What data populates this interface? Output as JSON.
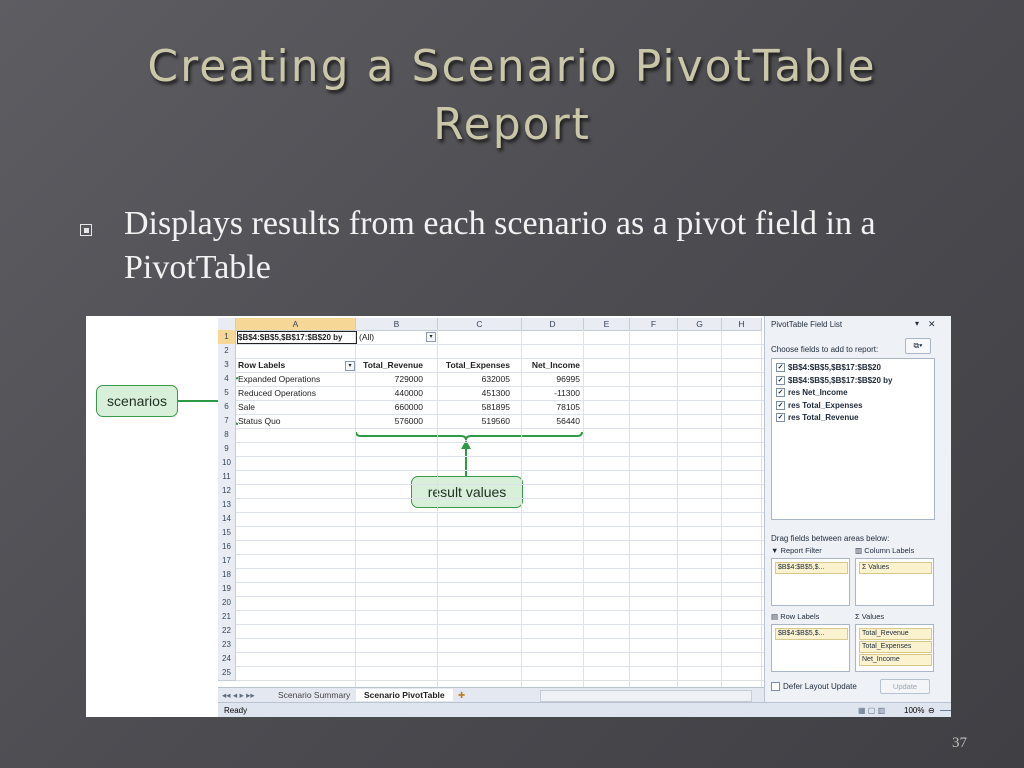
{
  "slide": {
    "title_line1": "Creating a Scenario PivotTable",
    "title_line2": "Report",
    "bullet": "Displays results from each scenario as a pivot field in a PivotTable",
    "slide_number": "37"
  },
  "sheet": {
    "columns": [
      "A",
      "B",
      "C",
      "D",
      "E",
      "F",
      "G",
      "H"
    ],
    "rows": [
      "1",
      "2",
      "3",
      "4",
      "5",
      "6",
      "7",
      "8",
      "9",
      "10",
      "11",
      "12",
      "13",
      "14",
      "15",
      "16",
      "17",
      "18",
      "19",
      "20",
      "21",
      "22",
      "23",
      "24",
      "25"
    ],
    "filter_field": "$B$4:$B$5,$B$17:$B$20 by",
    "filter_value": "(All)",
    "headers": [
      "Row Labels",
      "Total_Revenue",
      "Total_Expenses",
      "Net_Income"
    ],
    "data": [
      [
        "Expanded Operations",
        "729000",
        "632005",
        "96995"
      ],
      [
        "Reduced Operations",
        "440000",
        "451300",
        "-11300"
      ],
      [
        "Sale",
        "660000",
        "581895",
        "78105"
      ],
      [
        "Status Quo",
        "576000",
        "519560",
        "56440"
      ]
    ],
    "tabs": [
      "Scenario Summary",
      "Scenario PivotTable"
    ],
    "status_text": "Ready",
    "zoom": "100%"
  },
  "callouts": {
    "scenarios": "scenarios",
    "result_values": "result values"
  },
  "field_list": {
    "title": "PivotTable Field List",
    "choose_label": "Choose fields to add to report:",
    "fields": [
      {
        "label": "$B$4:$B$5,$B$17:$B$20",
        "checked": true
      },
      {
        "label": "$B$4:$B$5,$B$17:$B$20 by",
        "checked": true
      },
      {
        "label": "res Net_Income",
        "checked": true
      },
      {
        "label": "res Total_Expenses",
        "checked": true
      },
      {
        "label": "res Total_Revenue",
        "checked": true
      }
    ],
    "drag_label": "Drag fields between areas below:",
    "report_filter_label": "Report Filter",
    "column_labels_label": "Column Labels",
    "row_labels_label": "Row Labels",
    "values_label": "Values",
    "report_filter_item": "$B$4:$B$5,$...",
    "column_item": "Values",
    "row_item": "$B$4:$B$5,$...",
    "value_items": [
      "Total_Revenue",
      "Total_Expenses",
      "Net_Income"
    ],
    "defer_label": "Defer Layout Update",
    "update_label": "Update"
  }
}
